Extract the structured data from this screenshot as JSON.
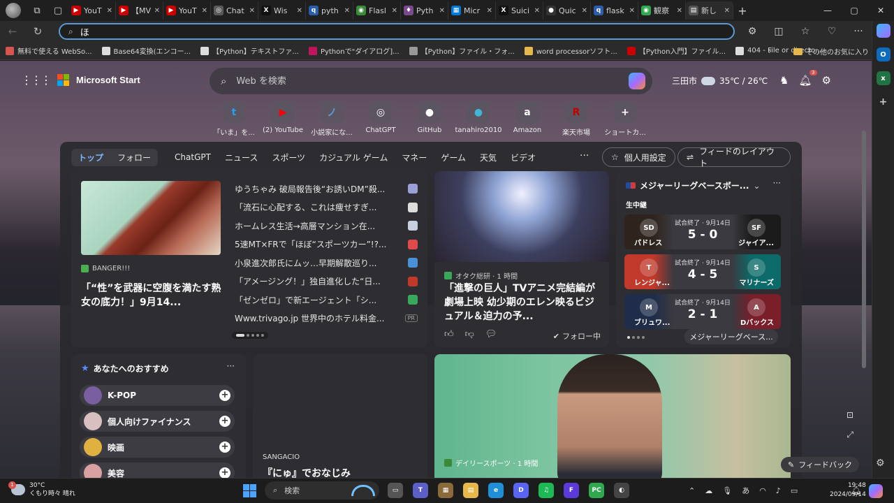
{
  "browser": {
    "tabs": [
      {
        "label": "YouT",
        "color": "#cc0000",
        "glyph": "▶"
      },
      {
        "label": "【MV",
        "color": "#cc0000",
        "glyph": "▶"
      },
      {
        "label": "YouT",
        "color": "#cc0000",
        "glyph": "▶"
      },
      {
        "label": "Chat",
        "color": "#5a5a5a",
        "glyph": "◎"
      },
      {
        "label": "Wis",
        "color": "#111111",
        "glyph": "X"
      },
      {
        "label": "pyth",
        "color": "#2b5ea8",
        "glyph": "q"
      },
      {
        "label": "Flasl",
        "color": "#3a8a3a",
        "glyph": "◉"
      },
      {
        "label": "Pyth",
        "color": "#7a4a8a",
        "glyph": "♦"
      },
      {
        "label": "Micr",
        "color": "#0078d4",
        "glyph": "▦"
      },
      {
        "label": "Suici",
        "color": "#111111",
        "glyph": "X"
      },
      {
        "label": "Quic",
        "color": "#333333",
        "glyph": "●"
      },
      {
        "label": "flask",
        "color": "#2b5ea8",
        "glyph": "q"
      },
      {
        "label": "観察",
        "color": "#2fa84f",
        "glyph": "◉"
      },
      {
        "label": "新し",
        "color": "#555555",
        "glyph": "▤"
      }
    ],
    "address_value": "ほ",
    "favorites": [
      {
        "label": "無料で使える WebSo...",
        "color": "#d9534f"
      },
      {
        "label": "Base64変換(エンコー...",
        "color": "#dddddd"
      },
      {
        "label": "【Python】テキストファ...",
        "color": "#dddddd"
      },
      {
        "label": "Pythonで\"ダイアログ]...",
        "color": "#c0145c"
      },
      {
        "label": "【Python】ファイル・フォ...",
        "color": "#999999"
      },
      {
        "label": "word processorソフト...",
        "color": "#e6b84c"
      },
      {
        "label": "【Python入門】ファイル...",
        "color": "#cc0000"
      },
      {
        "label": "404 - File or directo...",
        "color": "#dddddd"
      }
    ],
    "favorites_other": "その他のお気に入り"
  },
  "header": {
    "brand": "Microsoft Start",
    "search_placeholder": "Web を検索",
    "location": "三田市",
    "temperature": "35℃ / 26℃",
    "notification_count": "3"
  },
  "shortcuts": [
    {
      "label": "「いま」を...",
      "glyph": "t",
      "color": "#1da1f2"
    },
    {
      "label": "(2) YouTube",
      "glyph": "▶",
      "color": "#ff0000"
    },
    {
      "label": "小説家にな...",
      "glyph": "ノ",
      "color": "#5b9bd5"
    },
    {
      "label": "ChatGPT",
      "glyph": "◎",
      "color": "#555555"
    },
    {
      "label": "GitHub",
      "glyph": "●",
      "color": "#333333"
    },
    {
      "label": "tanahiro2010",
      "glyph": "●",
      "color": "#3fb6d8"
    },
    {
      "label": "Amazon",
      "glyph": "a",
      "color": "#222222"
    },
    {
      "label": "楽天市場",
      "glyph": "R",
      "color": "#bf0000"
    },
    {
      "label": "ショートカ...",
      "glyph": "+",
      "color": "#555555"
    }
  ],
  "feed_nav": {
    "tabs": [
      "トップ",
      "フォロー",
      "ChatGPT",
      "ニュース",
      "スポーツ",
      "カジュアル ゲーム",
      "マネー",
      "ゲーム",
      "天気",
      "ビデオ"
    ],
    "more": "···",
    "personalize": "個人用設定",
    "layout": "フィードのレイアウト"
  },
  "top_story": {
    "source": "BANGER!!!",
    "headline": "「“性”を武器に空腹を満たす熟女の底力！」9月14...",
    "list": [
      {
        "title": "ゆうちゃみ 破局報告後“お誘いDM”殺...",
        "color": "#9aa0d6"
      },
      {
        "title": "「流石に心配する、これは痩せすぎ...",
        "color": "#dddddd"
      },
      {
        "title": "ホームレス生活→高層マンション在...",
        "color": "#c8d0e0"
      },
      {
        "title": "5速MT×FRで「ほぼ“スポーツカー”!?...",
        "color": "#e04a4a"
      },
      {
        "title": "小泉進次郎氏にムッ…早期解散巡り...",
        "color": "#4a90d9"
      },
      {
        "title": "「アメージング！」独自進化した“日...",
        "color": "#c0392b"
      },
      {
        "title": "「ゼンゼロ」で新エージェント「シ...",
        "color": "#3aa85a"
      },
      {
        "title": "Www.trivago.jp 世界中のホテル料金...",
        "color": "#555555",
        "pr": "PR"
      }
    ]
  },
  "anime_card": {
    "source": "オタク総研 · 1 時間",
    "headline": "「進撃の巨人」TVアニメ完結編が劇場上映 幼少期のエレン映るビジュアル＆迫力の予...",
    "follow": "フォロー中"
  },
  "mlb": {
    "title": "メジャーリーグベースボー...",
    "live_label": "生中継",
    "games": [
      {
        "status": "試合終了 · 9月14日",
        "score": "5 - 0",
        "home": "パドレス",
        "away": "ジャイア...",
        "home_color": "#2f241d",
        "away_color": "#1b1b1b",
        "home_logo": "SD",
        "away_logo": "SF"
      },
      {
        "status": "試合終了 · 9月14日",
        "score": "4 - 5",
        "home": "レンジャ...",
        "away": "マリナーズ",
        "home_color": "#c0392b",
        "away_color": "#0c6b6a",
        "home_logo": "T",
        "away_logo": "S"
      },
      {
        "status": "試合終了 · 9月14日",
        "score": "2 - 1",
        "home": "ブリュワ...",
        "away": "Dバックス",
        "home_color": "#1f2d4a",
        "away_color": "#7a1e2a",
        "home_logo": "M",
        "away_logo": "A"
      }
    ],
    "more_label": "メジャーリーグベース..."
  },
  "recommend": {
    "title": "あなたへのおすすめ",
    "items": [
      {
        "label": "K-POP",
        "color": "#7a5fa0"
      },
      {
        "label": "個人向けファイナンス",
        "color": "#d8c0c0"
      },
      {
        "label": "映画",
        "color": "#e0b040"
      },
      {
        "label": "美容",
        "color": "#d8a0a0"
      }
    ]
  },
  "sangacio": {
    "category": "SANGACIO",
    "headline": "『にゅ』でおなじみ"
  },
  "big_story": {
    "source": "デイリースポーツ · 1 時間"
  },
  "feedback_label": "フィードバック",
  "taskbar": {
    "weather_temp": "30°C",
    "weather_desc": "くもり時々 晴れ",
    "weather_badge": "1",
    "search_placeholder": "検索",
    "apps": [
      {
        "glyph": "▭",
        "color": "#555555"
      },
      {
        "glyph": "T",
        "color": "#5b5fc7"
      },
      {
        "glyph": "▦",
        "color": "#8a6a3a"
      },
      {
        "glyph": "▤",
        "color": "#e6b84c"
      },
      {
        "glyph": "e",
        "color": "#1f8fd8"
      },
      {
        "glyph": "D",
        "color": "#5865f2"
      },
      {
        "glyph": "♫",
        "color": "#1db954"
      },
      {
        "glyph": "F",
        "color": "#5a3ad8"
      },
      {
        "glyph": "PC",
        "color": "#2fa84f"
      },
      {
        "glyph": "◐",
        "color": "#444444"
      }
    ],
    "ime": "あ",
    "time": "19:48",
    "date": "2024/09/14"
  }
}
